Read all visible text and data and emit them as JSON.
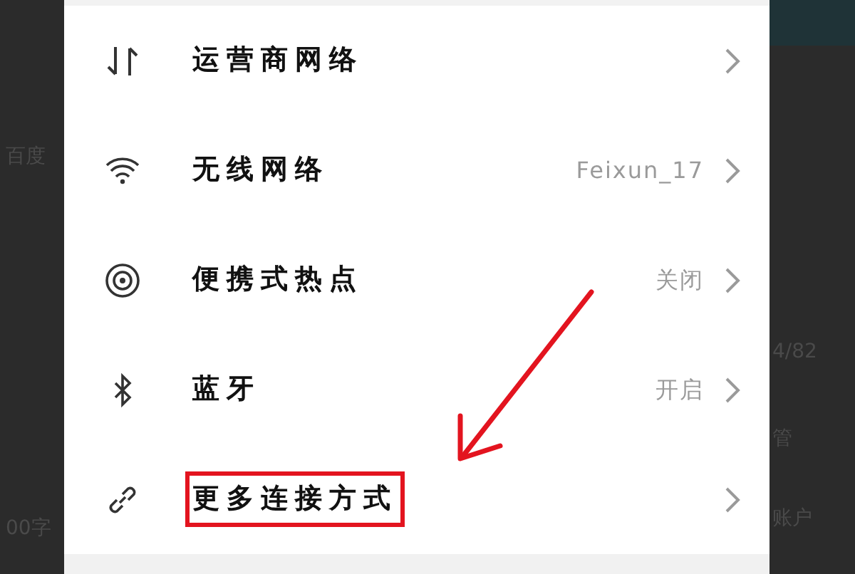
{
  "background_left": {
    "texts": [
      "百度",
      "00字"
    ]
  },
  "background_right": {
    "texts": [
      "4/82",
      "管",
      "账户"
    ]
  },
  "settings": [
    {
      "kind": "updown",
      "label": "运营商网络",
      "highlighted": false
    },
    {
      "kind": "wifi",
      "label": "无线网络",
      "value": "Feixun_17",
      "highlighted": false
    },
    {
      "kind": "hotspot",
      "label": "便携式热点",
      "value": "关闭",
      "highlighted": false
    },
    {
      "kind": "bluetooth",
      "label": "蓝牙",
      "value": "开启",
      "highlighted": false
    },
    {
      "kind": "link",
      "label": "更多连接方式",
      "highlighted": true
    }
  ]
}
